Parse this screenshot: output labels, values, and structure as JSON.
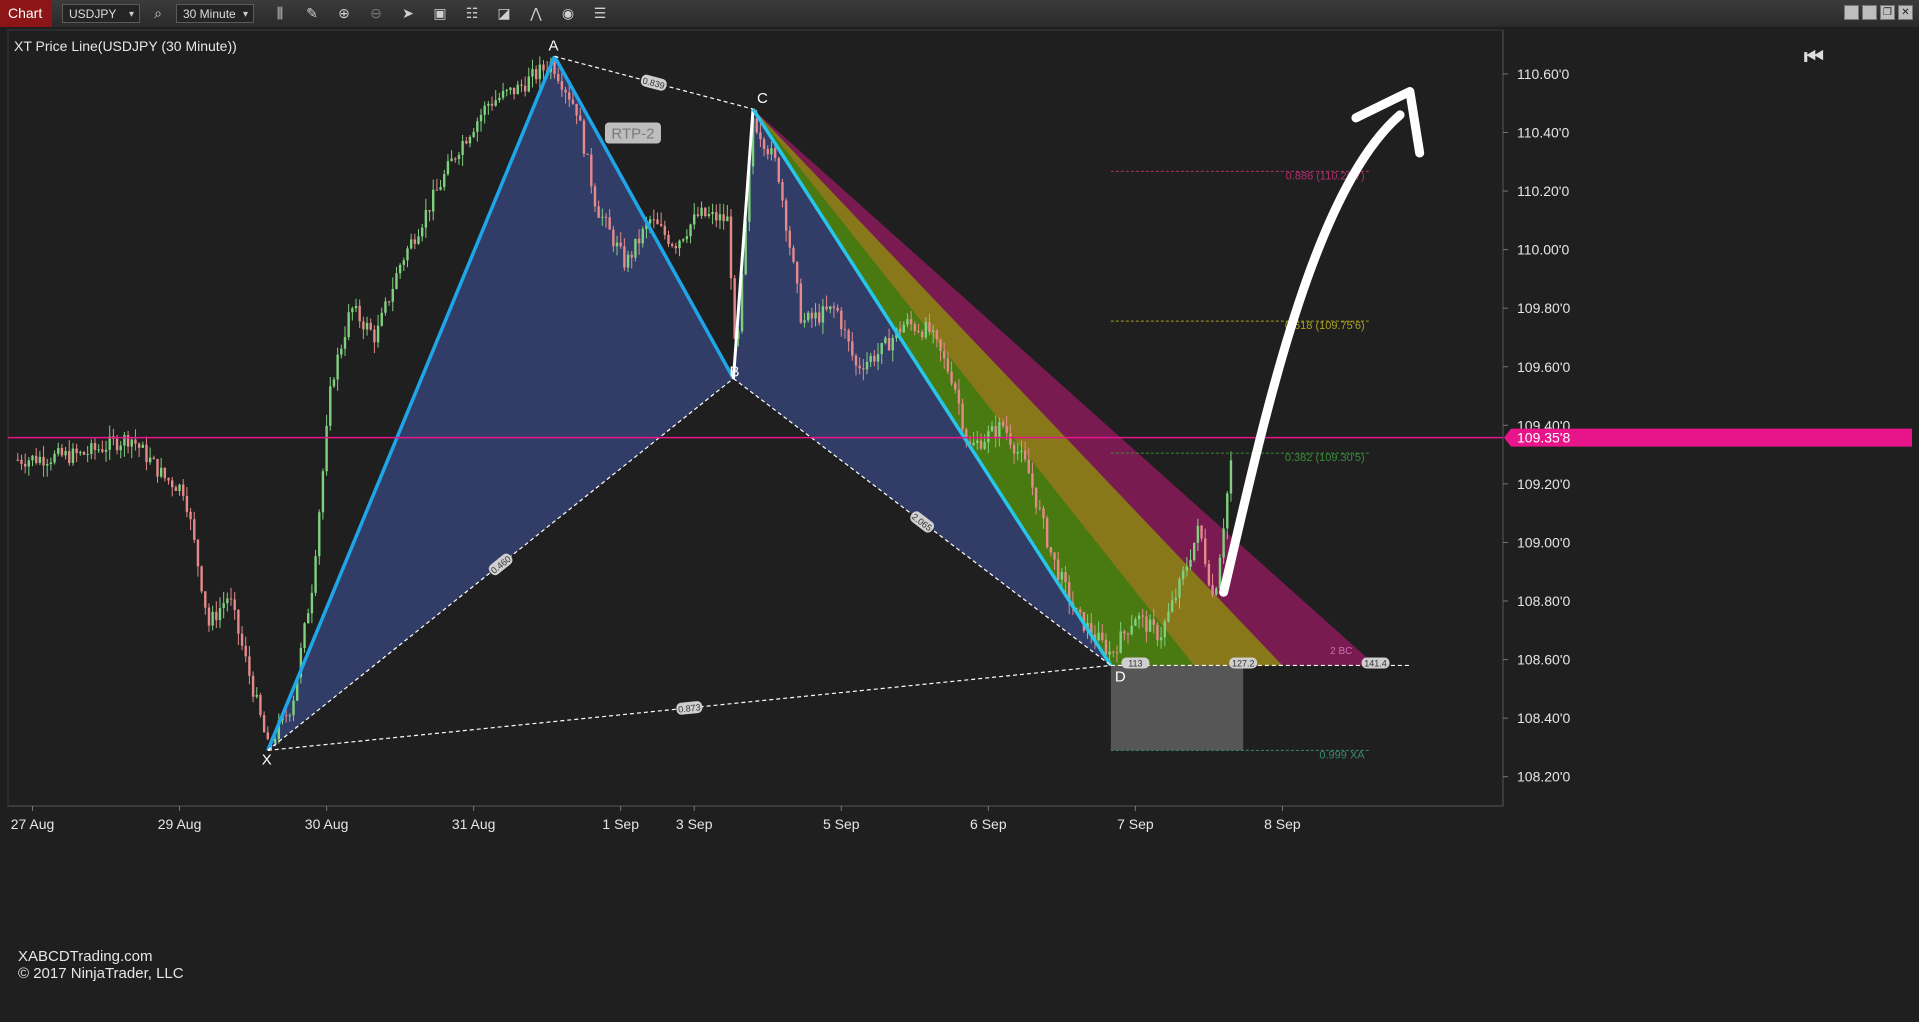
{
  "toolbar": {
    "chart_label": "Chart",
    "instrument": "USDJPY",
    "timeframe": "30 Minute",
    "tools": [
      "search-icon",
      "bar-type-icon",
      "pencil-icon",
      "zoom-in-icon",
      "zoom-out-icon",
      "pointer-icon",
      "properties-icon",
      "indicators-icon",
      "strategies-icon",
      "drawing-icon",
      "templates-icon",
      "list-icon"
    ],
    "window_buttons": [
      "tile-icon",
      "cascade-icon",
      "restore-icon",
      "close-icon"
    ]
  },
  "chart": {
    "title": "XT Price Line(USDJPY (30 Minute))",
    "watermark_line1": "XABCDTrading.com",
    "watermark_line2": "© 2017 NinjaTrader, LLC",
    "current_price": "109.35'8",
    "price_axis": {
      "min": 108.1,
      "max": 110.75,
      "labels": [
        "110.60'0",
        "110.40'0",
        "110.20'0",
        "110.00'0",
        "109.80'0",
        "109.60'0",
        "109.40'0",
        "109.20'0",
        "109.00'0",
        "108.80'0",
        "108.60'0",
        "108.40'0",
        "108.20'0"
      ],
      "label_values": [
        110.6,
        110.4,
        110.2,
        110.0,
        109.8,
        109.6,
        109.4,
        109.2,
        109.0,
        108.8,
        108.6,
        108.4,
        108.2
      ]
    },
    "time_axis": {
      "labels": [
        "27 Aug",
        "29 Aug",
        "30 Aug",
        "31 Aug",
        "1 Sep",
        "3 Sep",
        "5 Sep",
        "6 Sep",
        "7 Sep",
        "8 Sep"
      ],
      "positions": [
        0.5,
        3.5,
        6.5,
        9.5,
        12.5,
        14.0,
        17.0,
        20.0,
        23.0,
        26.0
      ]
    },
    "pattern": {
      "name": "RTP-2",
      "points": [
        {
          "label": "X",
          "t": 5.3,
          "price": 108.29
        },
        {
          "label": "A",
          "t": 11.15,
          "price": 110.66
        },
        {
          "label": "B",
          "t": 14.8,
          "price": 109.56
        },
        {
          "label": "C",
          "t": 15.2,
          "price": 110.48
        },
        {
          "label": "D",
          "t": 22.5,
          "price": 108.58
        }
      ],
      "ratios": [
        {
          "text": "0.839",
          "between": "A-C"
        },
        {
          "text": "0.460",
          "between": "X-B"
        },
        {
          "text": "2.065",
          "between": "B-D"
        },
        {
          "text": "0.873",
          "between": "X-D"
        }
      ]
    },
    "fib_levels": [
      {
        "label": "0.886 (110.26'7)",
        "price": 110.267,
        "color": "#b0306e"
      },
      {
        "label": "0.618 (109.75'6)",
        "price": 109.756,
        "color": "#a8a020"
      },
      {
        "label": "0.382 (109.30'5)",
        "price": 109.305,
        "color": "#3a8a3a"
      },
      {
        "label": "0.999 XA",
        "price": 108.29,
        "color": "#3a8a6a"
      }
    ],
    "projection_labels": [
      {
        "text": "113",
        "price": 108.59
      },
      {
        "text": "127.2",
        "price": 108.59
      },
      {
        "text": "2 BC",
        "price": 108.63
      },
      {
        "text": "141.4",
        "price": 108.59
      }
    ],
    "colors": {
      "background": "#1f1f1f",
      "pattern_fill": "#34406e",
      "pattern_edge": "#1fa6e8",
      "price_line": "#e8148a",
      "band_magenta": "#8a1a5a",
      "band_yellow": "#8b8a10",
      "band_green": "#3d7a10",
      "candle_up": "#7fd07f",
      "candle_down": "#e48a8a"
    }
  }
}
